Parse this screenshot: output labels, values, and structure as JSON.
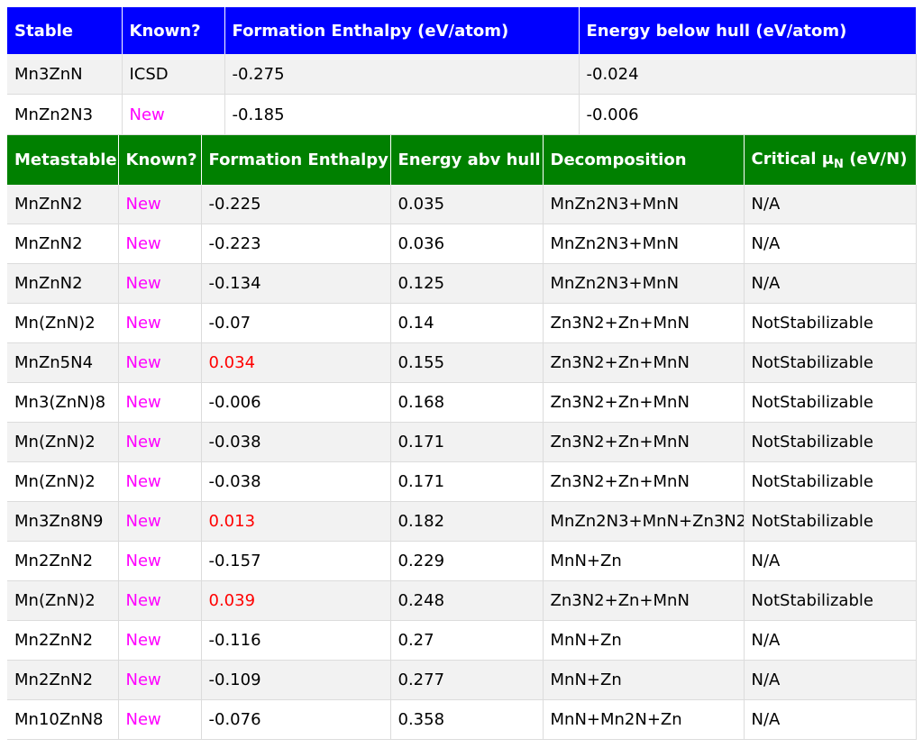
{
  "stable": {
    "headers": [
      "Stable",
      "Known?",
      "Formation Enthalpy (eV/atom)",
      "Energy below hull (eV/atom)"
    ],
    "rows": [
      {
        "compound": "Mn3ZnN",
        "known": "ICSD",
        "enthalpy": "-0.275",
        "hull": "-0.024"
      },
      {
        "compound": "MnZn2N3",
        "known": "New",
        "enthalpy": "-0.185",
        "hull": "-0.006"
      }
    ]
  },
  "metastable": {
    "headers": {
      "compound": "Metastable",
      "known": "Known?",
      "enthalpy": "Formation Enthalpy",
      "hull": "Energy abv hull",
      "decomposition": "Decomposition",
      "critical_prefix": "Critical μ",
      "critical_sub": "N",
      "critical_suffix": " (eV/N)"
    },
    "rows": [
      {
        "compound": "MnZnN2",
        "known": "New",
        "enthalpy": "-0.225",
        "hull": "0.035",
        "decomposition": "MnZn2N3+MnN",
        "critical": "N/A"
      },
      {
        "compound": "MnZnN2",
        "known": "New",
        "enthalpy": "-0.223",
        "hull": "0.036",
        "decomposition": "MnZn2N3+MnN",
        "critical": "N/A"
      },
      {
        "compound": "MnZnN2",
        "known": "New",
        "enthalpy": "-0.134",
        "hull": "0.125",
        "decomposition": "MnZn2N3+MnN",
        "critical": "N/A"
      },
      {
        "compound": "Mn(ZnN)2",
        "known": "New",
        "enthalpy": "-0.07",
        "hull": "0.14",
        "decomposition": "Zn3N2+Zn+MnN",
        "critical": "NotStabilizable"
      },
      {
        "compound": "MnZn5N4",
        "known": "New",
        "enthalpy": "0.034",
        "hull": "0.155",
        "decomposition": "Zn3N2+Zn+MnN",
        "critical": "NotStabilizable"
      },
      {
        "compound": "Mn3(ZnN)8",
        "known": "New",
        "enthalpy": "-0.006",
        "hull": "0.168",
        "decomposition": "Zn3N2+Zn+MnN",
        "critical": "NotStabilizable"
      },
      {
        "compound": "Mn(ZnN)2",
        "known": "New",
        "enthalpy": "-0.038",
        "hull": "0.171",
        "decomposition": "Zn3N2+Zn+MnN",
        "critical": "NotStabilizable"
      },
      {
        "compound": "Mn(ZnN)2",
        "known": "New",
        "enthalpy": "-0.038",
        "hull": "0.171",
        "decomposition": "Zn3N2+Zn+MnN",
        "critical": "NotStabilizable"
      },
      {
        "compound": "Mn3Zn8N9",
        "known": "New",
        "enthalpy": "0.013",
        "hull": "0.182",
        "decomposition": "MnZn2N3+MnN+Zn3N2",
        "critical": "NotStabilizable"
      },
      {
        "compound": "Mn2ZnN2",
        "known": "New",
        "enthalpy": "-0.157",
        "hull": "0.229",
        "decomposition": "MnN+Zn",
        "critical": "N/A"
      },
      {
        "compound": "Mn(ZnN)2",
        "known": "New",
        "enthalpy": "0.039",
        "hull": "0.248",
        "decomposition": "Zn3N2+Zn+MnN",
        "critical": "NotStabilizable"
      },
      {
        "compound": "Mn2ZnN2",
        "known": "New",
        "enthalpy": "-0.116",
        "hull": "0.27",
        "decomposition": "MnN+Zn",
        "critical": "N/A"
      },
      {
        "compound": "Mn2ZnN2",
        "known": "New",
        "enthalpy": "-0.109",
        "hull": "0.277",
        "decomposition": "MnN+Zn",
        "critical": "N/A"
      },
      {
        "compound": "Mn10ZnN8",
        "known": "New",
        "enthalpy": "-0.076",
        "hull": "0.358",
        "decomposition": "MnN+Mn2N+Zn",
        "critical": "N/A"
      }
    ]
  },
  "colors": {
    "stable_header": "#0000ff",
    "metastable_header": "#008000",
    "new_label": "#ff00ff",
    "positive_enthalpy": "#ff0000"
  }
}
